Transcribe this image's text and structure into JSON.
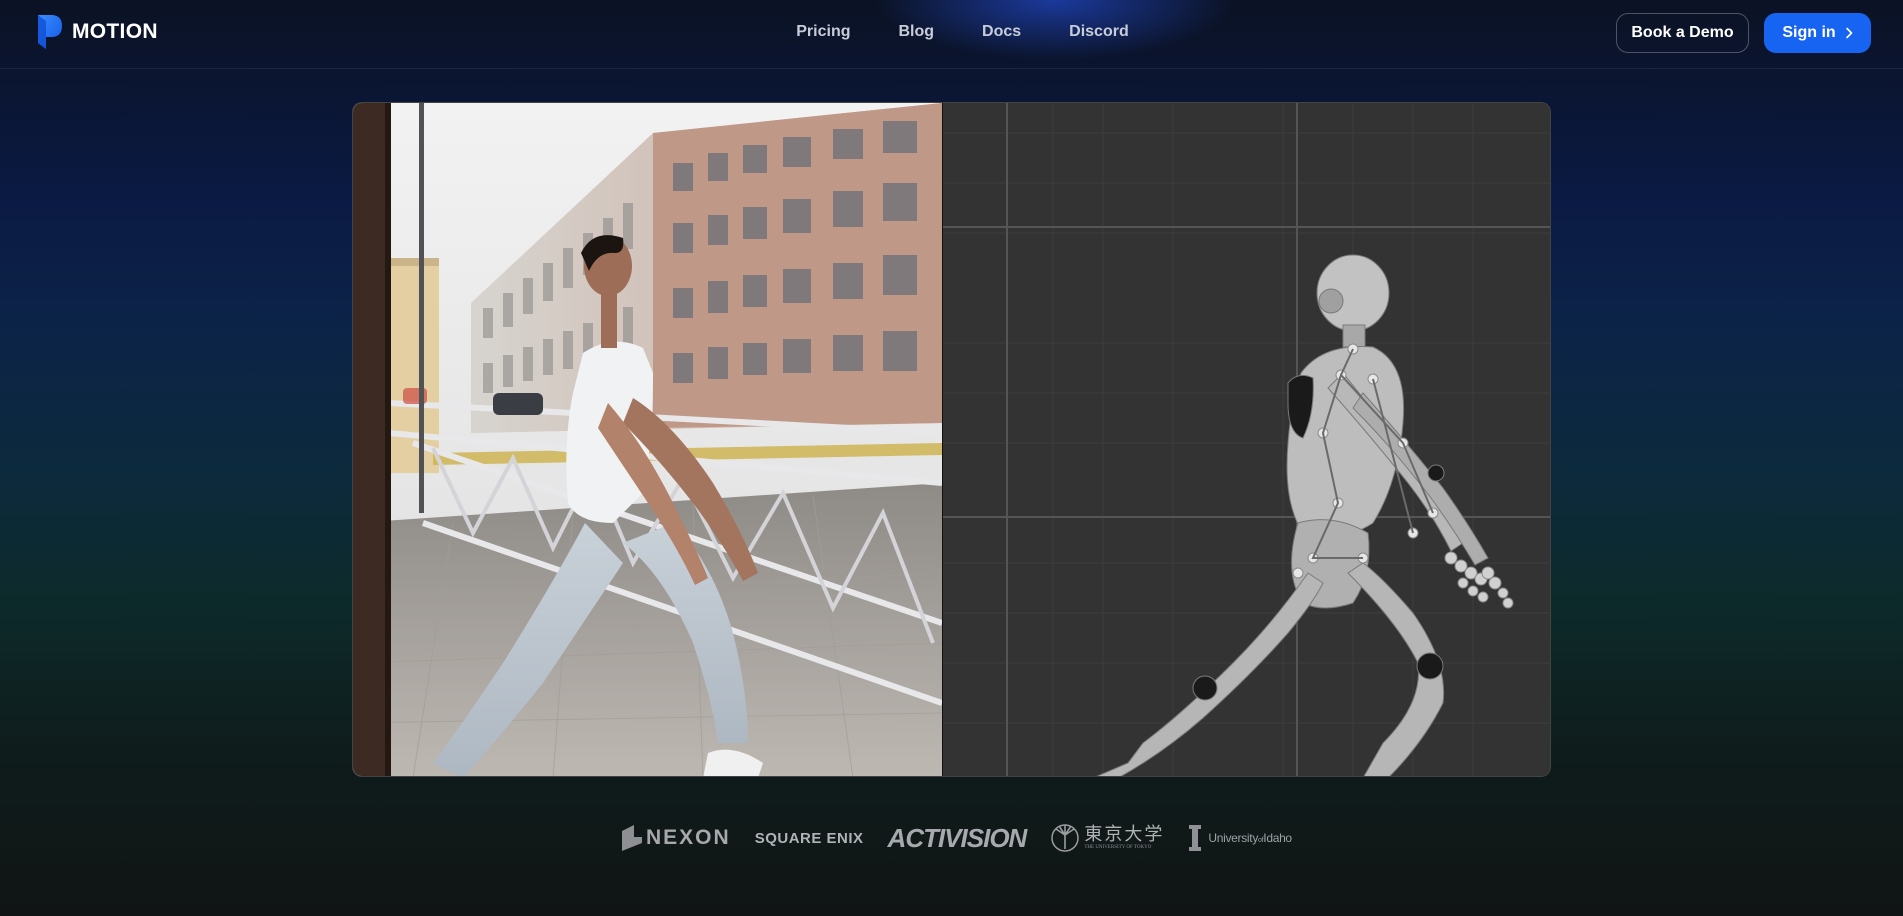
{
  "brand": {
    "name": "MOTION",
    "accent_color": "#1864f2"
  },
  "nav": {
    "items": [
      {
        "label": "Pricing"
      },
      {
        "label": "Blog"
      },
      {
        "label": "Docs"
      },
      {
        "label": "Discord"
      }
    ]
  },
  "header_actions": {
    "book_demo_label": "Book a Demo",
    "sign_in_label": "Sign in",
    "sign_in_icon": "chevron-right-icon"
  },
  "demo": {
    "left_pane": "dancer-video-frame",
    "right_pane": "3d-mannequin-render"
  },
  "customer_logos": {
    "nexon": "NEXON",
    "square_enix": "SQUARE ENIX",
    "activision": "ACTIVISION",
    "utokyo_jp": "東京大学",
    "utokyo_en": "THE UNIVERSITY OF TOKYO",
    "uidaho_main": "University",
    "uidaho_of": "of",
    "uidaho_name": "Idaho"
  }
}
